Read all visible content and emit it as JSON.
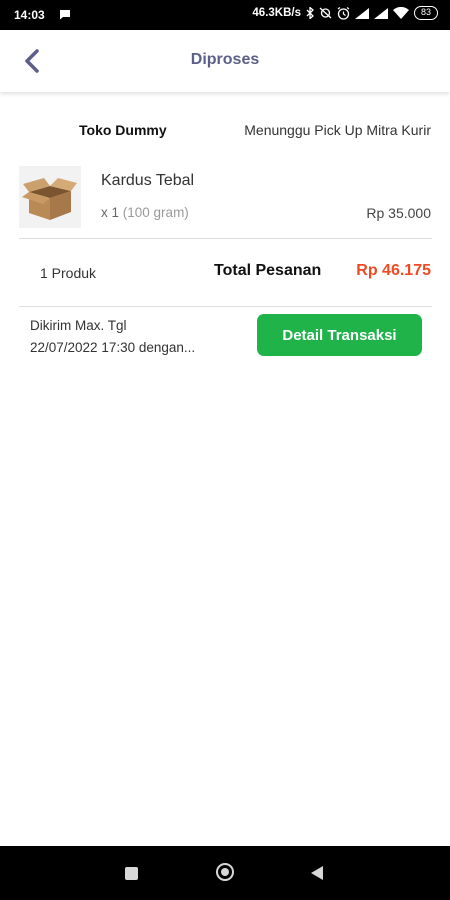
{
  "status_bar": {
    "time": "14:03",
    "network_speed": "46.3KB/s",
    "battery": "83"
  },
  "header": {
    "title": "Diproses"
  },
  "order": {
    "store_name": "Toko Dummy",
    "status": "Menunggu Pick Up Mitra Kurir",
    "product": {
      "name": "Kardus Tebal",
      "quantity": "x 1",
      "weight": "(100 gram)",
      "price": "Rp 35.000"
    },
    "product_count": "1 Produk",
    "total_label": "Total Pesanan",
    "total_value": "Rp 46.175",
    "shipping_line1": "Dikirim Max. Tgl",
    "shipping_line2": "22/07/2022 17:30 dengan...",
    "detail_button": "Detail Transaksi"
  },
  "colors": {
    "accent_green": "#1fb34a",
    "total_orange": "#ef4a23",
    "title_purple": "#5b5f8a"
  }
}
